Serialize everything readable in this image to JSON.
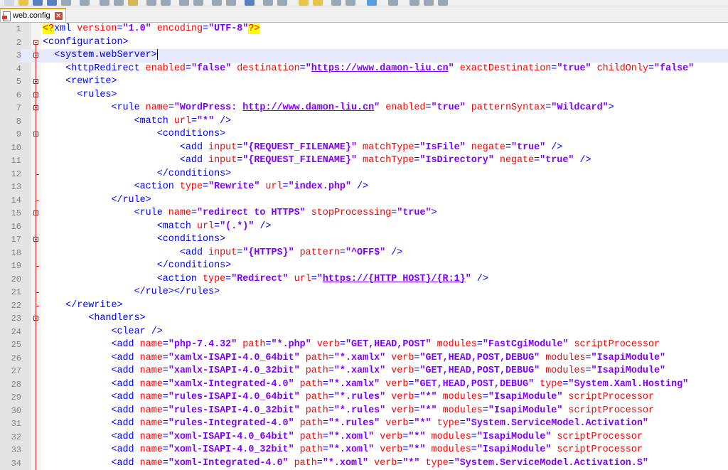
{
  "tab": {
    "label": "web.config"
  },
  "lines": [
    {
      "n": "1",
      "indent": 0,
      "segs": [
        [
          "pi",
          "<?"
        ],
        [
          "x",
          "xml"
        ],
        [
          "a",
          " version"
        ],
        [
          "x",
          "="
        ],
        [
          "v",
          "\"1.0\""
        ],
        [
          "a",
          " encoding"
        ],
        [
          "x",
          "="
        ],
        [
          "v",
          "\"UTF-8\""
        ],
        [
          "pi",
          "?>"
        ]
      ]
    },
    {
      "n": "2",
      "indent": 0,
      "segs": [
        [
          "t",
          "<configuration>"
        ]
      ]
    },
    {
      "n": "3",
      "indent": 2,
      "current": true,
      "segs": [
        [
          "t",
          "<system.webServer>"
        ]
      ],
      "cursor": true
    },
    {
      "n": "4",
      "indent": 4,
      "segs": [
        [
          "t",
          "<httpRedirect"
        ],
        [
          "a",
          " enabled"
        ],
        [
          "x",
          "="
        ],
        [
          "v",
          "\"false\""
        ],
        [
          "a",
          " destination"
        ],
        [
          "x",
          "="
        ],
        [
          "v",
          "\""
        ],
        [
          "u",
          "https://www.damon-liu.cn"
        ],
        [
          "v",
          "\""
        ],
        [
          "a",
          " exactDestination"
        ],
        [
          "x",
          "="
        ],
        [
          "v",
          "\"true\""
        ],
        [
          "a",
          " childOnly"
        ],
        [
          "x",
          "="
        ],
        [
          "v",
          "\"false\""
        ]
      ]
    },
    {
      "n": "5",
      "indent": 4,
      "segs": [
        [
          "t",
          "<rewrite>"
        ]
      ]
    },
    {
      "n": "6",
      "indent": 6,
      "segs": [
        [
          "t",
          "<rules>"
        ]
      ]
    },
    {
      "n": "7",
      "indent": 12,
      "segs": [
        [
          "t",
          "<rule"
        ],
        [
          "a",
          " name"
        ],
        [
          "x",
          "="
        ],
        [
          "v",
          "\"WordPress: "
        ],
        [
          "u",
          "http://www.damon-liu.cn"
        ],
        [
          "v",
          "\""
        ],
        [
          "a",
          " enabled"
        ],
        [
          "x",
          "="
        ],
        [
          "v",
          "\"true\""
        ],
        [
          "a",
          " patternSyntax"
        ],
        [
          "x",
          "="
        ],
        [
          "v",
          "\"Wildcard\""
        ],
        [
          "t",
          ">"
        ]
      ]
    },
    {
      "n": "8",
      "indent": 16,
      "segs": [
        [
          "t",
          "<match"
        ],
        [
          "a",
          " url"
        ],
        [
          "x",
          "="
        ],
        [
          "v",
          "\"*\""
        ],
        [
          "t",
          " />"
        ]
      ]
    },
    {
      "n": "9",
      "indent": 20,
      "segs": [
        [
          "t",
          "<conditions>"
        ]
      ]
    },
    {
      "n": "10",
      "indent": 24,
      "segs": [
        [
          "t",
          "<add"
        ],
        [
          "a",
          " input"
        ],
        [
          "x",
          "="
        ],
        [
          "v",
          "\"{REQUEST_FILENAME}\""
        ],
        [
          "a",
          " matchType"
        ],
        [
          "x",
          "="
        ],
        [
          "v",
          "\"IsFile\""
        ],
        [
          "a",
          " negate"
        ],
        [
          "x",
          "="
        ],
        [
          "v",
          "\"true\""
        ],
        [
          "t",
          " />"
        ]
      ]
    },
    {
      "n": "11",
      "indent": 24,
      "segs": [
        [
          "t",
          "<add"
        ],
        [
          "a",
          " input"
        ],
        [
          "x",
          "="
        ],
        [
          "v",
          "\"{REQUEST_FILENAME}\""
        ],
        [
          "a",
          " matchType"
        ],
        [
          "x",
          "="
        ],
        [
          "v",
          "\"IsDirectory\""
        ],
        [
          "a",
          " negate"
        ],
        [
          "x",
          "="
        ],
        [
          "v",
          "\"true\""
        ],
        [
          "t",
          " />"
        ]
      ]
    },
    {
      "n": "12",
      "indent": 20,
      "segs": [
        [
          "t",
          "</conditions>"
        ]
      ]
    },
    {
      "n": "13",
      "indent": 16,
      "segs": [
        [
          "t",
          "<action"
        ],
        [
          "a",
          " type"
        ],
        [
          "x",
          "="
        ],
        [
          "v",
          "\"Rewrite\""
        ],
        [
          "a",
          " url"
        ],
        [
          "x",
          "="
        ],
        [
          "v",
          "\"index.php\""
        ],
        [
          "t",
          " />"
        ]
      ]
    },
    {
      "n": "14",
      "indent": 12,
      "segs": [
        [
          "t",
          "</rule>"
        ]
      ]
    },
    {
      "n": "15",
      "indent": 16,
      "segs": [
        [
          "t",
          "<rule"
        ],
        [
          "a",
          " name"
        ],
        [
          "x",
          "="
        ],
        [
          "v",
          "\"redirect to HTTPS\""
        ],
        [
          "a",
          " stopProcessing"
        ],
        [
          "x",
          "="
        ],
        [
          "v",
          "\"true\""
        ],
        [
          "t",
          ">"
        ]
      ]
    },
    {
      "n": "16",
      "indent": 20,
      "segs": [
        [
          "t",
          "<match"
        ],
        [
          "a",
          " url"
        ],
        [
          "x",
          "="
        ],
        [
          "v",
          "\"(.*)\""
        ],
        [
          "t",
          " />"
        ]
      ]
    },
    {
      "n": "17",
      "indent": 20,
      "segs": [
        [
          "t",
          "<conditions>"
        ]
      ]
    },
    {
      "n": "18",
      "indent": 24,
      "segs": [
        [
          "t",
          "<add"
        ],
        [
          "a",
          " input"
        ],
        [
          "x",
          "="
        ],
        [
          "v",
          "\"{HTTPS}\""
        ],
        [
          "a",
          " pattern"
        ],
        [
          "x",
          "="
        ],
        [
          "v",
          "\"^OFF$\""
        ],
        [
          "t",
          " />"
        ]
      ]
    },
    {
      "n": "19",
      "indent": 20,
      "segs": [
        [
          "t",
          "</conditions>"
        ]
      ]
    },
    {
      "n": "20",
      "indent": 20,
      "segs": [
        [
          "t",
          "<action"
        ],
        [
          "a",
          " type"
        ],
        [
          "x",
          "="
        ],
        [
          "v",
          "\"Redirect\""
        ],
        [
          "a",
          " url"
        ],
        [
          "x",
          "="
        ],
        [
          "v",
          "\""
        ],
        [
          "u",
          "https://{HTTP_HOST}/{R:1}"
        ],
        [
          "v",
          "\""
        ],
        [
          "t",
          " />"
        ]
      ]
    },
    {
      "n": "21",
      "indent": 16,
      "segs": [
        [
          "t",
          "</rule></rules>"
        ]
      ]
    },
    {
      "n": "22",
      "indent": 4,
      "segs": [
        [
          "t",
          "</rewrite>"
        ]
      ]
    },
    {
      "n": "23",
      "indent": 8,
      "segs": [
        [
          "t",
          "<handlers>"
        ]
      ]
    },
    {
      "n": "24",
      "indent": 12,
      "segs": [
        [
          "t",
          "<clear"
        ],
        [
          "t",
          " />"
        ]
      ]
    },
    {
      "n": "25",
      "indent": 12,
      "segs": [
        [
          "t",
          "<add"
        ],
        [
          "a",
          " name"
        ],
        [
          "x",
          "="
        ],
        [
          "v",
          "\"php-7.4.32\""
        ],
        [
          "a",
          " path"
        ],
        [
          "x",
          "="
        ],
        [
          "v",
          "\"*.php\""
        ],
        [
          "a",
          " verb"
        ],
        [
          "x",
          "="
        ],
        [
          "v",
          "\"GET,HEAD,POST\""
        ],
        [
          "a",
          " modules"
        ],
        [
          "x",
          "="
        ],
        [
          "v",
          "\"FastCgiModule\""
        ],
        [
          "a",
          " scriptProcessor"
        ]
      ]
    },
    {
      "n": "26",
      "indent": 12,
      "segs": [
        [
          "t",
          "<add"
        ],
        [
          "a",
          " name"
        ],
        [
          "x",
          "="
        ],
        [
          "v",
          "\"xamlx-ISAPI-4.0_64bit\""
        ],
        [
          "a",
          " path"
        ],
        [
          "x",
          "="
        ],
        [
          "v",
          "\"*.xamlx\""
        ],
        [
          "a",
          " verb"
        ],
        [
          "x",
          "="
        ],
        [
          "v",
          "\"GET,HEAD,POST,DEBUG\""
        ],
        [
          "a",
          " modules"
        ],
        [
          "x",
          "="
        ],
        [
          "v",
          "\"IsapiModule\""
        ]
      ]
    },
    {
      "n": "27",
      "indent": 12,
      "segs": [
        [
          "t",
          "<add"
        ],
        [
          "a",
          " name"
        ],
        [
          "x",
          "="
        ],
        [
          "v",
          "\"xamlx-ISAPI-4.0_32bit\""
        ],
        [
          "a",
          " path"
        ],
        [
          "x",
          "="
        ],
        [
          "v",
          "\"*.xamlx\""
        ],
        [
          "a",
          " verb"
        ],
        [
          "x",
          "="
        ],
        [
          "v",
          "\"GET,HEAD,POST,DEBUG\""
        ],
        [
          "a",
          " modules"
        ],
        [
          "x",
          "="
        ],
        [
          "v",
          "\"IsapiModule\""
        ]
      ]
    },
    {
      "n": "28",
      "indent": 12,
      "segs": [
        [
          "t",
          "<add"
        ],
        [
          "a",
          " name"
        ],
        [
          "x",
          "="
        ],
        [
          "v",
          "\"xamlx-Integrated-4.0\""
        ],
        [
          "a",
          " path"
        ],
        [
          "x",
          "="
        ],
        [
          "v",
          "\"*.xamlx\""
        ],
        [
          "a",
          " verb"
        ],
        [
          "x",
          "="
        ],
        [
          "v",
          "\"GET,HEAD,POST,DEBUG\""
        ],
        [
          "a",
          " type"
        ],
        [
          "x",
          "="
        ],
        [
          "v",
          "\"System.Xaml.Hosting\""
        ]
      ]
    },
    {
      "n": "29",
      "indent": 12,
      "segs": [
        [
          "t",
          "<add"
        ],
        [
          "a",
          " name"
        ],
        [
          "x",
          "="
        ],
        [
          "v",
          "\"rules-ISAPI-4.0_64bit\""
        ],
        [
          "a",
          " path"
        ],
        [
          "x",
          "="
        ],
        [
          "v",
          "\"*.rules\""
        ],
        [
          "a",
          " verb"
        ],
        [
          "x",
          "="
        ],
        [
          "v",
          "\"*\""
        ],
        [
          "a",
          " modules"
        ],
        [
          "x",
          "="
        ],
        [
          "v",
          "\"IsapiModule\""
        ],
        [
          "a",
          " scriptProcessor"
        ]
      ]
    },
    {
      "n": "30",
      "indent": 12,
      "segs": [
        [
          "t",
          "<add"
        ],
        [
          "a",
          " name"
        ],
        [
          "x",
          "="
        ],
        [
          "v",
          "\"rules-ISAPI-4.0_32bit\""
        ],
        [
          "a",
          " path"
        ],
        [
          "x",
          "="
        ],
        [
          "v",
          "\"*.rules\""
        ],
        [
          "a",
          " verb"
        ],
        [
          "x",
          "="
        ],
        [
          "v",
          "\"*\""
        ],
        [
          "a",
          " modules"
        ],
        [
          "x",
          "="
        ],
        [
          "v",
          "\"IsapiModule\""
        ],
        [
          "a",
          " scriptProcessor"
        ]
      ]
    },
    {
      "n": "31",
      "indent": 12,
      "segs": [
        [
          "t",
          "<add"
        ],
        [
          "a",
          " name"
        ],
        [
          "x",
          "="
        ],
        [
          "v",
          "\"rules-Integrated-4.0\""
        ],
        [
          "a",
          " path"
        ],
        [
          "x",
          "="
        ],
        [
          "v",
          "\"*.rules\""
        ],
        [
          "a",
          " verb"
        ],
        [
          "x",
          "="
        ],
        [
          "v",
          "\"*\""
        ],
        [
          "a",
          " type"
        ],
        [
          "x",
          "="
        ],
        [
          "v",
          "\"System.ServiceModel.Activation\""
        ]
      ]
    },
    {
      "n": "32",
      "indent": 12,
      "segs": [
        [
          "t",
          "<add"
        ],
        [
          "a",
          " name"
        ],
        [
          "x",
          "="
        ],
        [
          "v",
          "\"xoml-ISAPI-4.0_64bit\""
        ],
        [
          "a",
          " path"
        ],
        [
          "x",
          "="
        ],
        [
          "v",
          "\"*.xoml\""
        ],
        [
          "a",
          " verb"
        ],
        [
          "x",
          "="
        ],
        [
          "v",
          "\"*\""
        ],
        [
          "a",
          " modules"
        ],
        [
          "x",
          "="
        ],
        [
          "v",
          "\"IsapiModule\""
        ],
        [
          "a",
          " scriptProcessor"
        ]
      ]
    },
    {
      "n": "33",
      "indent": 12,
      "segs": [
        [
          "t",
          "<add"
        ],
        [
          "a",
          " name"
        ],
        [
          "x",
          "="
        ],
        [
          "v",
          "\"xoml-ISAPI-4.0_32bit\""
        ],
        [
          "a",
          " path"
        ],
        [
          "x",
          "="
        ],
        [
          "v",
          "\"*.xoml\""
        ],
        [
          "a",
          " verb"
        ],
        [
          "x",
          "="
        ],
        [
          "v",
          "\"*\""
        ],
        [
          "a",
          " modules"
        ],
        [
          "x",
          "="
        ],
        [
          "v",
          "\"IsapiModule\""
        ],
        [
          "a",
          " scriptProcessor"
        ]
      ]
    },
    {
      "n": "34",
      "indent": 12,
      "segs": [
        [
          "t",
          "<add"
        ],
        [
          "a",
          " name"
        ],
        [
          "x",
          "="
        ],
        [
          "v",
          "\"xoml-Integrated-4.0\""
        ],
        [
          "a",
          " path"
        ],
        [
          "x",
          "="
        ],
        [
          "v",
          "\"*.xoml\""
        ],
        [
          "a",
          " verb"
        ],
        [
          "x",
          "="
        ],
        [
          "v",
          "\"*\""
        ],
        [
          "a",
          " type"
        ],
        [
          "x",
          "="
        ],
        [
          "v",
          "\"System.ServiceModel.Activation.S\""
        ]
      ]
    }
  ]
}
